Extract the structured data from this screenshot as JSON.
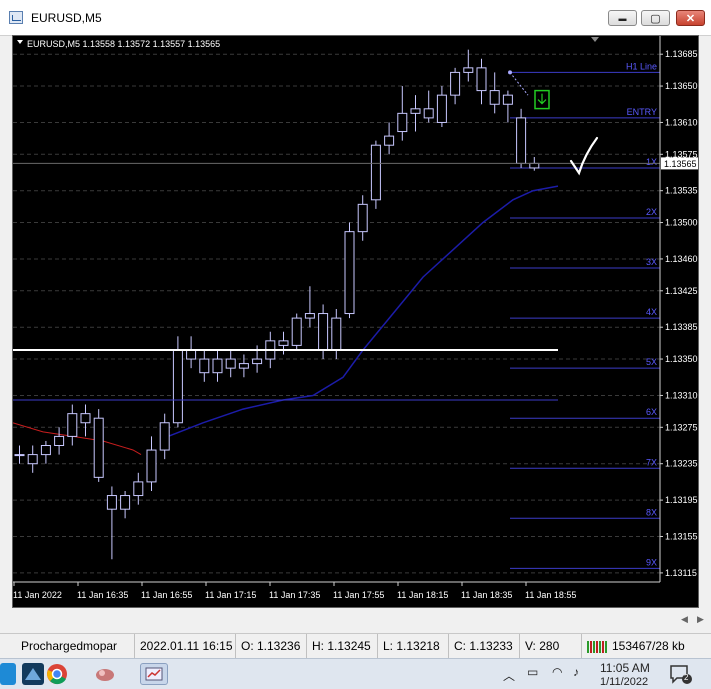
{
  "window": {
    "title": "EURUSD,M5",
    "minimize_glyph": "▬",
    "maximize_glyph": "▢",
    "close_glyph": "✕"
  },
  "chart": {
    "header": "EURUSD,M5  1.13558 1.13572 1.13557 1.13565",
    "ylim": [
      1.13105,
      1.13705
    ],
    "price_labels": [
      "1.13685",
      "1.13650",
      "1.13610",
      "1.13575",
      "1.13535",
      "1.13500",
      "1.13460",
      "1.13425",
      "1.13385",
      "1.13350",
      "1.13310",
      "1.13275",
      "1.13235",
      "1.13195",
      "1.13155",
      "1.13115"
    ],
    "current_price": "1.13565",
    "time_labels": [
      "11 Jan 2022",
      "11 Jan 16:35",
      "11 Jan 16:55",
      "11 Jan 17:15",
      "11 Jan 17:35",
      "11 Jan 17:55",
      "11 Jan 18:15",
      "11 Jan 18:35",
      "11 Jan 18:55"
    ],
    "levels": [
      {
        "label": "H1 Line",
        "price": 1.13665
      },
      {
        "label": "ENTRY",
        "price": 1.13615
      },
      {
        "label": "1X",
        "price": 1.1356
      },
      {
        "label": "2X",
        "price": 1.13505
      },
      {
        "label": "3X",
        "price": 1.1345
      },
      {
        "label": "4X",
        "price": 1.13395
      },
      {
        "label": "5X",
        "price": 1.1334
      },
      {
        "label": "6X",
        "price": 1.13285
      },
      {
        "label": "7X",
        "price": 1.1323
      },
      {
        "label": "8X",
        "price": 1.13175
      },
      {
        "label": "9X",
        "price": 1.1312
      }
    ],
    "white_line_price": 1.1336,
    "blue_line_price": 1.13305,
    "colors": {
      "background": "#000000",
      "grid": "#3a3a3a",
      "candle": "#c8c8ff",
      "level": "#3c3cc8",
      "level_text": "#5a5aff",
      "ma_blue": "#1c1ca8",
      "ma_red": "#c81e1e",
      "white_line": "#ffffff",
      "entry_marker": "#22cc22"
    }
  },
  "status": {
    "profile": "Prochargedmopar",
    "datetime": "2022.01.11 16:15",
    "open": "O: 1.13236",
    "high": "H: 1.13245",
    "low": "L: 1.13218",
    "close": "C: 1.13233",
    "volume": "V: 280",
    "traffic": "153467/28 kb"
  },
  "taskbar": {
    "time": "11:05 AM",
    "date": "1/11/2022",
    "notification_count": "2"
  }
}
